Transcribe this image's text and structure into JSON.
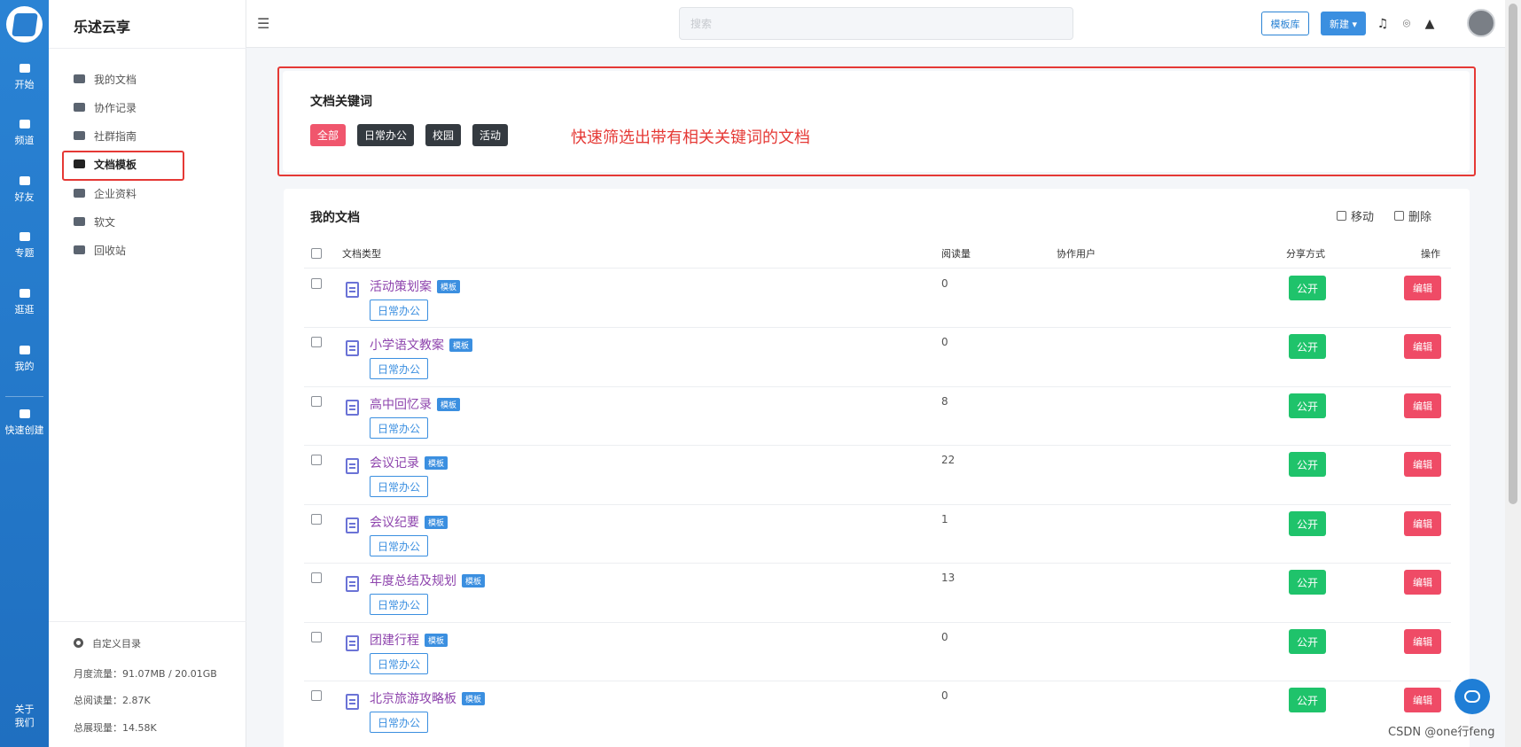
{
  "rail": {
    "items": [
      {
        "label": "开始"
      },
      {
        "label": "频道"
      },
      {
        "label": "好友"
      },
      {
        "label": "专题"
      },
      {
        "label": "逛逛"
      },
      {
        "label": "我的"
      },
      {
        "label": "快速创建"
      }
    ],
    "bottom_line1": "关于",
    "bottom_line2": "我们"
  },
  "sidebar": {
    "brand": "乐述云享",
    "items": [
      {
        "label": "我的文档"
      },
      {
        "label": "协作记录"
      },
      {
        "label": "社群指南"
      },
      {
        "label": "文档模板"
      },
      {
        "label": "企业资料"
      },
      {
        "label": "软文"
      },
      {
        "label": "回收站"
      }
    ],
    "custom_dir": "自定义目录",
    "monthly_traffic": "月度流量：91.07MB / 20.01GB",
    "total_reads": "总阅读量：2.87K",
    "total_views": "总展现量：14.58K"
  },
  "topbar": {
    "search_placeholder": "搜索",
    "template_lib": "模板库",
    "new_label": "新建 ▾"
  },
  "keywords": {
    "title": "文档关键词",
    "tags": [
      "全部",
      "日常办公",
      "校园",
      "活动"
    ],
    "annotation": "快速筛选出带有相关关键词的文档"
  },
  "docs": {
    "title": "我的文档",
    "move": "移动",
    "delete": "删除",
    "headers": {
      "type": "文档类型",
      "reads": "阅读量",
      "collab": "协作用户",
      "share": "分享方式",
      "ops": "操作"
    },
    "rows": [
      {
        "name": "活动策划案",
        "badge": "模板",
        "category": "日常办公",
        "reads": "0",
        "share": "公开",
        "edit": "编辑"
      },
      {
        "name": "小学语文教案",
        "badge": "模板",
        "category": "日常办公",
        "reads": "0",
        "share": "公开",
        "edit": "编辑"
      },
      {
        "name": "高中回忆录",
        "badge": "模板",
        "category": "日常办公",
        "reads": "8",
        "share": "公开",
        "edit": "编辑"
      },
      {
        "name": "会议记录",
        "badge": "模板",
        "category": "日常办公",
        "reads": "22",
        "share": "公开",
        "edit": "编辑"
      },
      {
        "name": "会议纪要",
        "badge": "模板",
        "category": "日常办公",
        "reads": "1",
        "share": "公开",
        "edit": "编辑"
      },
      {
        "name": "年度总结及规划",
        "badge": "模板",
        "category": "日常办公",
        "reads": "13",
        "share": "公开",
        "edit": "编辑"
      },
      {
        "name": "团建行程",
        "badge": "模板",
        "category": "日常办公",
        "reads": "0",
        "share": "公开",
        "edit": "编辑"
      },
      {
        "name": "北京旅游攻略板",
        "badge": "模板",
        "category": "日常办公",
        "reads": "0",
        "share": "公开",
        "edit": "编辑"
      }
    ]
  },
  "watermark": "CSDN @one行feng",
  "colors": {
    "rail": "#2a83d4",
    "accent": "#3b8fe0",
    "share": "#1fc36b",
    "edit": "#ef4b66",
    "highlight": "#e53935"
  }
}
